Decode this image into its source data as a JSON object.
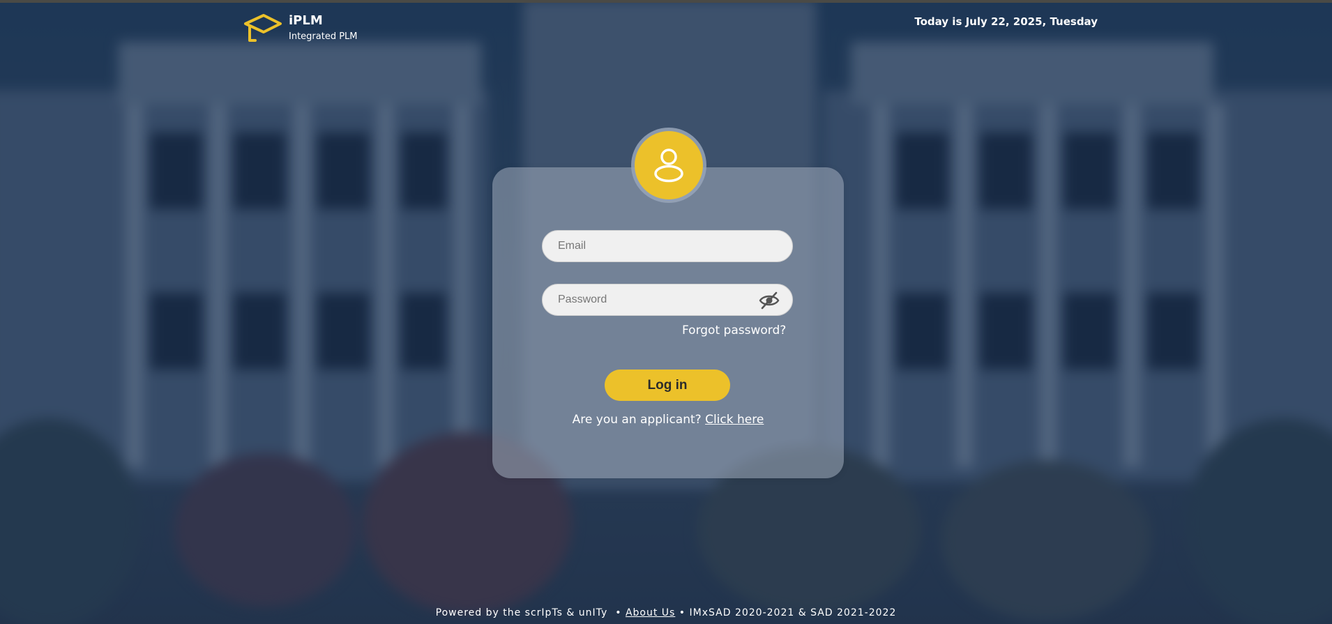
{
  "header": {
    "app_name": "iPLM",
    "app_subtitle": "Integrated PLM",
    "today_text": "Today is July 22, 2025, Tuesday"
  },
  "login": {
    "avatar_icon": "user-icon",
    "email_placeholder": "Email",
    "email_value": "",
    "password_placeholder": "Password",
    "password_value": "",
    "password_toggle_icon": "eye-slash-icon",
    "forgot_label": "Forgot password?",
    "login_label": "Log in",
    "applicant_prompt": "Are you an applicant?",
    "applicant_link": "Click here"
  },
  "footer": {
    "powered_text": "Powered by the scrIpTs & unITy",
    "sep1": "•",
    "about_label": "About Us",
    "sep2": "•",
    "credits": "IMxSAD 2020-2021 & SAD 2021-2022"
  },
  "colors": {
    "accent": "#ecc12a",
    "card": "rgba(160,172,188,0.55)",
    "background": "#2a4561"
  }
}
